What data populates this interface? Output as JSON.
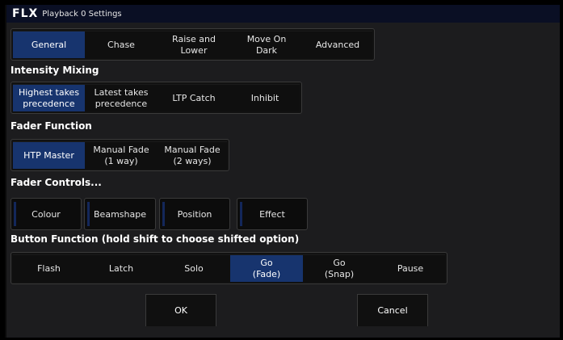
{
  "window": {
    "logo": "FLX",
    "title": "Playback 0 Settings"
  },
  "tabs": [
    {
      "label": "General",
      "selected": true
    },
    {
      "label": "Chase",
      "selected": false
    },
    {
      "label": "Raise and\nLower",
      "selected": false
    },
    {
      "label": "Move On\nDark",
      "selected": false
    },
    {
      "label": "Advanced",
      "selected": false
    }
  ],
  "intensity_mixing": {
    "heading": "Intensity Mixing",
    "options": [
      {
        "label": "Highest takes\nprecedence",
        "selected": true
      },
      {
        "label": "Latest takes\nprecedence",
        "selected": false
      },
      {
        "label": "LTP Catch",
        "selected": false
      },
      {
        "label": "Inhibit",
        "selected": false
      }
    ]
  },
  "fader_function": {
    "heading": "Fader Function",
    "options": [
      {
        "label": "HTP Master",
        "selected": true
      },
      {
        "label": "Manual Fade\n(1 way)",
        "selected": false
      },
      {
        "label": "Manual Fade\n(2 ways)",
        "selected": false
      }
    ]
  },
  "fader_controls": {
    "heading": "Fader Controls...",
    "options": [
      {
        "label": "Colour"
      },
      {
        "label": "Beamshape"
      },
      {
        "label": "Position"
      },
      {
        "label": "Effect"
      }
    ]
  },
  "button_function": {
    "heading": "Button Function (hold shift to choose shifted option)",
    "options": [
      {
        "label": "Flash",
        "selected": false
      },
      {
        "label": "Latch",
        "selected": false
      },
      {
        "label": "Solo",
        "selected": false
      },
      {
        "label": "Go\n(Fade)",
        "selected": true
      },
      {
        "label": "Go\n(Snap)",
        "selected": false
      },
      {
        "label": "Pause",
        "selected": false
      }
    ]
  },
  "dialog": {
    "ok_label": "OK",
    "cancel_label": "Cancel"
  },
  "colors": {
    "selected": "#17346e",
    "background": "#1c1c1e",
    "titlebar": "#0a0f24"
  }
}
